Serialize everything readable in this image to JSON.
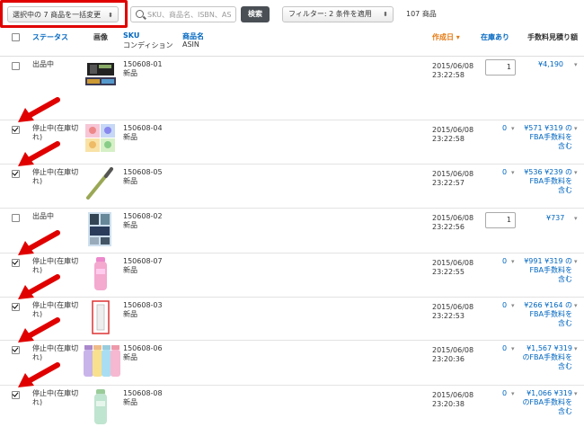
{
  "toolbar": {
    "bulk_label": "選択中の 7 商品を一括変更",
    "search_placeholder": "SKU、商品名、ISBN、AS",
    "search_button": "検索",
    "filter_label": "フィルター: 2 条件を適用",
    "count": "107 商品"
  },
  "columns": {
    "status": "ステータス",
    "image": "画像",
    "sku": "SKU",
    "condition": "コンディション",
    "name": "商品名",
    "asin": "ASIN",
    "date": "作成日 ▾",
    "stock": "在庫あり",
    "fee": "手数料見積り額"
  },
  "rows": [
    {
      "checked": false,
      "status": "出品中",
      "sku": "150608-01",
      "condition": "新品",
      "date": "2015/06/08",
      "time": "23:22:58",
      "stock_type": "input",
      "qty": "1",
      "fee": "¥4,190"
    },
    {
      "checked": true,
      "status": "停止中(在庫切れ)",
      "sku": "150608-04",
      "condition": "新品",
      "date": "2015/06/08",
      "time": "23:22:58",
      "stock_type": "zero",
      "qty": "0",
      "fee": "¥571 ¥319 のFBA手数料を含む"
    },
    {
      "checked": true,
      "status": "停止中(在庫切れ)",
      "sku": "150608-05",
      "condition": "新品",
      "date": "2015/06/08",
      "time": "23:22:57",
      "stock_type": "zero",
      "qty": "0",
      "fee": "¥536 ¥239 のFBA手数料を含む"
    },
    {
      "checked": false,
      "status": "出品中",
      "sku": "150608-02",
      "condition": "新品",
      "date": "2015/06/08",
      "time": "23:22:56",
      "stock_type": "input",
      "qty": "1",
      "fee": "¥737"
    },
    {
      "checked": true,
      "status": "停止中(在庫切れ)",
      "sku": "150608-07",
      "condition": "新品",
      "date": "2015/06/08",
      "time": "23:22:55",
      "stock_type": "zero",
      "qty": "0",
      "fee": "¥991 ¥319 のFBA手数料を含む"
    },
    {
      "checked": true,
      "status": "停止中(在庫切れ)",
      "sku": "150608-03",
      "condition": "新品",
      "date": "2015/06/08",
      "time": "23:22:53",
      "stock_type": "zero",
      "qty": "0",
      "fee": "¥266 ¥164 のFBA手数料を含む"
    },
    {
      "checked": true,
      "status": "停止中(在庫切れ)",
      "sku": "150608-06",
      "condition": "新品",
      "date": "2015/06/08",
      "time": "23:20:36",
      "stock_type": "zero",
      "qty": "0",
      "fee": "¥1,567 ¥319 のFBA手数料を含む"
    },
    {
      "checked": true,
      "status": "停止中(在庫切れ)",
      "sku": "150608-08",
      "condition": "新品",
      "date": "2015/06/08",
      "time": "23:20:38",
      "stock_type": "zero",
      "qty": "0",
      "fee": "¥1,066 ¥319 のFBA手数料を含む"
    }
  ],
  "colors": {
    "accent_red": "#e00000",
    "link_blue": "#0066c0",
    "sort_orange": "#e47911"
  }
}
